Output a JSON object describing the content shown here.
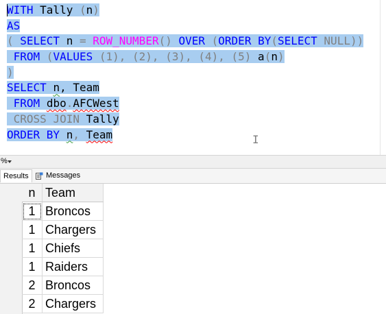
{
  "editor": {
    "lines": [
      [
        {
          "t": "WITH",
          "c": "kw",
          "sel": true
        },
        {
          "t": " Tally ",
          "c": "",
          "sel": true
        },
        {
          "t": "(",
          "c": "op",
          "sel": true
        },
        {
          "t": "n",
          "c": "",
          "sel": true
        },
        {
          "t": ")",
          "c": "op",
          "sel": true
        }
      ],
      [
        {
          "t": "AS",
          "c": "kw",
          "sel": true
        }
      ],
      [
        {
          "t": "( ",
          "c": "op",
          "sel": true
        },
        {
          "t": "SELECT",
          "c": "kw",
          "sel": true
        },
        {
          "t": " n ",
          "c": "",
          "sel": true
        },
        {
          "t": "=",
          "c": "op",
          "sel": true
        },
        {
          "t": " ",
          "c": "",
          "sel": true
        },
        {
          "t": "ROW_NUMBER",
          "c": "fn",
          "sel": true
        },
        {
          "t": "() ",
          "c": "op",
          "sel": true
        },
        {
          "t": "OVER",
          "c": "kw",
          "sel": true
        },
        {
          "t": " (",
          "c": "op",
          "sel": true
        },
        {
          "t": "ORDER BY",
          "c": "kw",
          "sel": true
        },
        {
          "t": "(",
          "c": "op",
          "sel": true
        },
        {
          "t": "SELECT",
          "c": "kw",
          "sel": true
        },
        {
          "t": " ",
          "c": "",
          "sel": true
        },
        {
          "t": "NULL",
          "c": "op",
          "sel": true
        },
        {
          "t": "))",
          "c": "op",
          "sel": true
        }
      ],
      [
        {
          "t": " ",
          "c": "",
          "sel": true
        },
        {
          "t": "FROM",
          "c": "kw",
          "sel": true
        },
        {
          "t": " (",
          "c": "op",
          "sel": true
        },
        {
          "t": "VALUES",
          "c": "kw",
          "sel": true
        },
        {
          "t": " (1), (2), (3), (4), (5)",
          "c": "op",
          "sel": true
        },
        {
          "t": " a",
          "c": "",
          "sel": true
        },
        {
          "t": "(",
          "c": "op",
          "sel": true
        },
        {
          "t": "n",
          "c": "",
          "sel": true
        },
        {
          "t": ")",
          "c": "op",
          "sel": true
        }
      ],
      [
        {
          "t": ")",
          "c": "op",
          "sel": true
        }
      ],
      [
        {
          "t": "SELECT",
          "c": "kw",
          "sel": true
        },
        {
          "t": " ",
          "c": "",
          "sel": true
        },
        {
          "t": "n",
          "c": "squig-g",
          "sel": true
        },
        {
          "t": ", Team",
          "c": "",
          "sel": true
        }
      ],
      [
        {
          "t": " ",
          "c": "",
          "sel": true
        },
        {
          "t": "FROM",
          "c": "kw",
          "sel": true
        },
        {
          "t": " ",
          "c": "",
          "sel": true
        },
        {
          "t": "dbo",
          "c": "squig",
          "sel": true
        },
        {
          "t": ".",
          "c": "op",
          "sel": true
        },
        {
          "t": "AFCWest",
          "c": "squig",
          "sel": true
        }
      ],
      [
        {
          "t": " ",
          "c": "",
          "sel": true
        },
        {
          "t": "CROSS JOIN",
          "c": "op",
          "sel": true
        },
        {
          "t": " Tally",
          "c": "",
          "sel": true
        }
      ],
      [
        {
          "t": "ORDER BY",
          "c": "kw",
          "sel": true
        },
        {
          "t": " ",
          "c": "",
          "sel": true
        },
        {
          "t": "n",
          "c": "squig-g",
          "sel": true
        },
        {
          "t": ", ",
          "c": "op",
          "sel": true
        },
        {
          "t": "Team",
          "c": "squig",
          "sel": true
        }
      ]
    ],
    "cursor_glyph": "I"
  },
  "zoombar": {
    "zoom_label": "%"
  },
  "tabs": {
    "results_label": "Results",
    "messages_label": "Messages"
  },
  "results": {
    "columns": [
      "n",
      "Team"
    ],
    "rows": [
      [
        "1",
        "Broncos"
      ],
      [
        "1",
        "Chargers"
      ],
      [
        "1",
        "Chiefs"
      ],
      [
        "1",
        "Raiders"
      ],
      [
        "2",
        "Broncos"
      ],
      [
        "2",
        "Chargers"
      ]
    ]
  },
  "colors": {
    "selection": "#a8cdf0",
    "keyword": "#0000ff",
    "function": "#ff00ff",
    "operator": "#808080"
  }
}
